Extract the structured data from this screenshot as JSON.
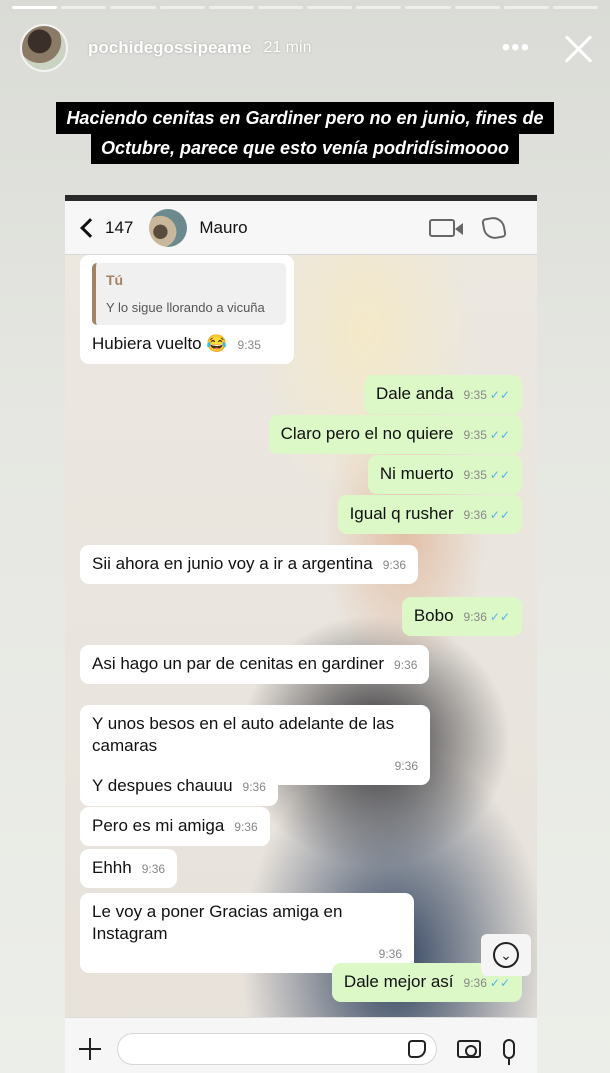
{
  "story": {
    "progress_segments": 12,
    "progress_done": 1,
    "username": "pochidegossipeame",
    "time": "21 min",
    "more_label": "•••",
    "caption_line1": "Haciendo cenitas en Gardiner pero no en junio, fines de",
    "caption_line2": "Octubre, parece que esto venía podridísimoooo"
  },
  "chat": {
    "back_count": "147",
    "contact_name": "Mauro",
    "quote": {
      "author": "Tú",
      "text": "Y lo sigue llorando a vicuña"
    },
    "messages": [
      {
        "dir": "in",
        "text": "Hubiera vuelto 😂",
        "time": "9:35"
      },
      {
        "dir": "out",
        "text": "Dale anda",
        "time": "9:35"
      },
      {
        "dir": "out",
        "text": "Claro pero el no quiere",
        "time": "9:35"
      },
      {
        "dir": "out",
        "text": "Ni muerto",
        "time": "9:35"
      },
      {
        "dir": "out",
        "text": "Igual q rusher",
        "time": "9:36"
      },
      {
        "dir": "in",
        "text": "Sii ahora en junio voy a ir a argentina",
        "time": "9:36"
      },
      {
        "dir": "out",
        "text": "Bobo",
        "time": "9:36"
      },
      {
        "dir": "in",
        "text": "Asi hago un par de cenitas en gardiner",
        "time": "9:36"
      },
      {
        "dir": "in",
        "text": "Y unos besos en el auto adelante de las camaras",
        "time": "9:36"
      },
      {
        "dir": "in",
        "text": "Y despues chauuu",
        "time": "9:36"
      },
      {
        "dir": "in",
        "text": "Pero es mi amiga",
        "time": "9:36"
      },
      {
        "dir": "in",
        "text": "Ehhh",
        "time": "9:36"
      },
      {
        "dir": "in",
        "text": "Le voy a poner Gracias amiga en Instagram",
        "time": "9:36"
      },
      {
        "dir": "out",
        "text": "Dale mejor así",
        "time": "9:36"
      }
    ],
    "read_ticks": "✓✓",
    "scroll_down_glyph": "⌄"
  },
  "colors": {
    "incoming_bubble": "#ffffff",
    "outgoing_bubble": "#dcf8c6",
    "read_tick": "#4fb6ec",
    "quote_accent": "#a48262"
  }
}
